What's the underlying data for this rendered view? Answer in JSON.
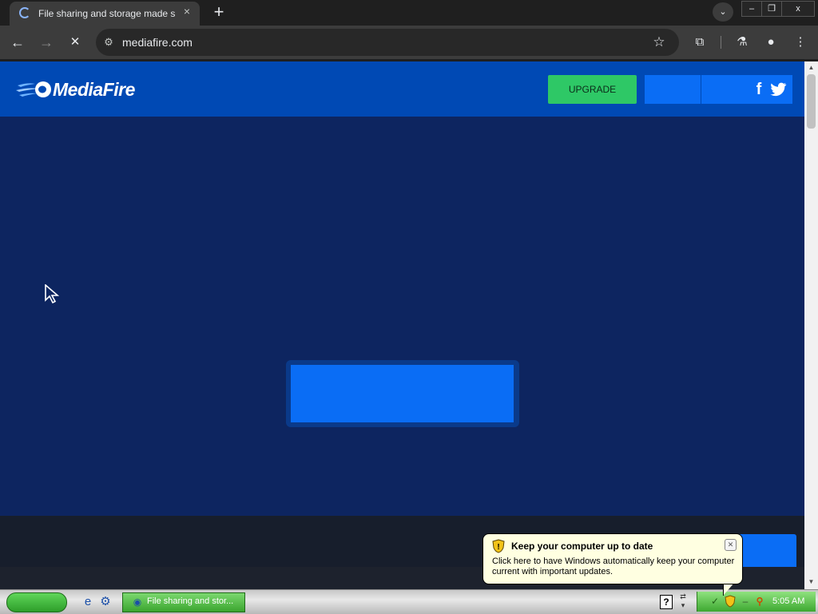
{
  "browser": {
    "tab": {
      "title": "File sharing and storage made sim",
      "close_icon": "×"
    },
    "new_tab_icon": "+",
    "tab_search_icon": "⌄",
    "window_controls": {
      "minimize": "–",
      "restore": "❐",
      "close": "x"
    },
    "nav": {
      "back": "←",
      "forward": "→",
      "stop": "✕"
    },
    "omnibox": {
      "url": "mediafire.com",
      "site_info_icon": "⚙",
      "bookmark_icon": "☆"
    },
    "toolbar_icons": {
      "extensions": "⧉",
      "labs": "⚗",
      "profile": "●",
      "menu": "⋮"
    }
  },
  "page": {
    "header": {
      "logo_text": "MediaFire",
      "upgrade_label": "UPGRADE",
      "facebook_label": "f"
    },
    "colors": {
      "header_bg": "#0049b4",
      "body_bg": "#0d2560",
      "button_blue": "#0a6df5",
      "upgrade_green": "#2ec866"
    }
  },
  "scrollbar": {
    "up": "▲",
    "down": "▼"
  },
  "taskbar": {
    "quick_launch": [
      "e",
      "⚙"
    ],
    "task": {
      "label": "File sharing and stor..."
    },
    "help_icon": "?",
    "clock": "5:05 AM"
  },
  "balloon": {
    "title": "Keep your computer up to date",
    "text": "Click here to have Windows automatically keep your computer current with important updates.",
    "close": "✕"
  }
}
